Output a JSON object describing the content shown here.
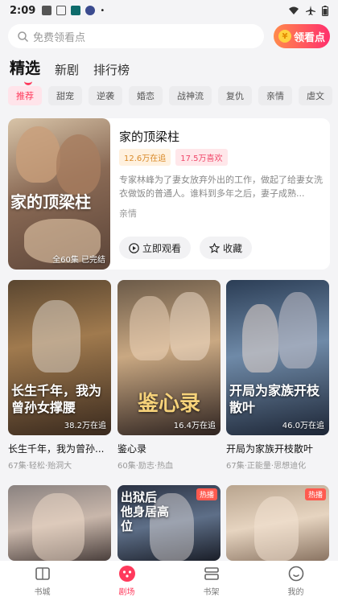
{
  "status": {
    "time": "2:09"
  },
  "search": {
    "placeholder": "免费领看点",
    "button_label": "领看点",
    "coin_glyph": "¥"
  },
  "tabs": [
    {
      "label": "精选",
      "active": true
    },
    {
      "label": "新剧",
      "active": false
    },
    {
      "label": "排行榜",
      "active": false
    }
  ],
  "chips": [
    "推荐",
    "甜宠",
    "逆袭",
    "婚恋",
    "战神流",
    "复仇",
    "亲情",
    "虐文"
  ],
  "hero": {
    "art_title": "家的顶梁柱",
    "episodes": "全60集 已完结",
    "title": "家的顶梁柱",
    "tag_following": "12.6万在追",
    "tag_likes": "17.5万喜欢",
    "description": "专家林峰为了妻女放弃外出的工作，做起了给妻女洗衣做饭的普通人。谁料到多年之后，妻子成熟...",
    "genre": "亲情",
    "watch_label": "立即观看",
    "collect_label": "收藏"
  },
  "cards": [
    {
      "art": "长生千年，我为曾孙女撑腰",
      "count": "38.2万在追",
      "name": "长生千年，我为曾孙...",
      "meta": "67集·轻松·贻洞大"
    },
    {
      "art": "鉴心录",
      "count": "16.4万在追",
      "name": "鉴心录",
      "meta": "60集·励志·热血"
    },
    {
      "art": "开局为家族开枝散叶",
      "count": "46.0万在追",
      "name": "开局为家族开枝散叶",
      "meta": "67集·正能量·思想迪化"
    }
  ],
  "row2": [
    {
      "badge": "",
      "art": ""
    },
    {
      "badge": "热播",
      "art": "出狱后 他身居高位"
    },
    {
      "badge": "热播",
      "art": ""
    }
  ],
  "bottomnav": [
    {
      "label": "书城",
      "active": false
    },
    {
      "label": "剧场",
      "active": true
    },
    {
      "label": "书架",
      "active": false
    },
    {
      "label": "我的",
      "active": false
    }
  ]
}
